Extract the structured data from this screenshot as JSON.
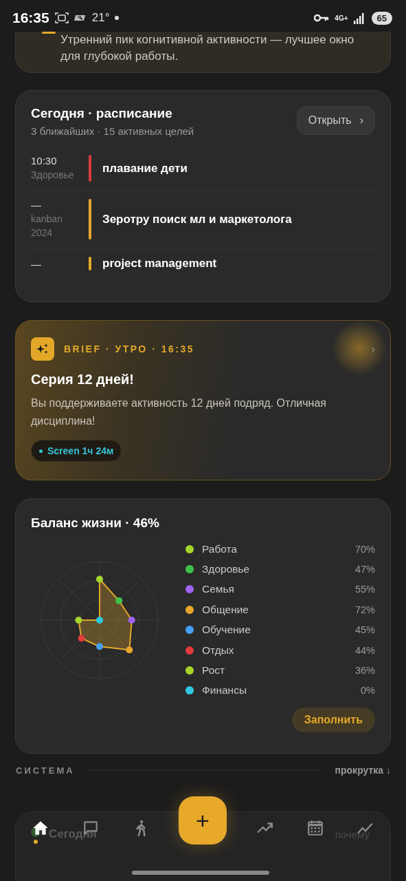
{
  "status_bar": {
    "time": "16:35",
    "temperature": "21°",
    "battery": "65",
    "network": "4G+"
  },
  "insight": {
    "text": "Утренний пик когнитивной активности — лучшее окно для глубокой работы."
  },
  "schedule": {
    "title": "Сегодня · расписание",
    "subtitle": "3 ближайших · 15 активных целей",
    "open_button": "Открыть",
    "chevron": "›",
    "items": [
      {
        "time": "10:30",
        "tag": "Здоровье",
        "title": "плавание дети",
        "color": "#d43c3c"
      },
      {
        "time": "—",
        "tag": "kanban 2024",
        "title": "Зеротру поиск мл и маркетолога",
        "color": "#e3a82a"
      },
      {
        "time": "—",
        "title": "project management",
        "color": "#e3a82a"
      }
    ]
  },
  "brief": {
    "label": "BRIEF · УТРО · 16:35",
    "chevron": "›",
    "title": "Серия 12 дней!",
    "text": "Вы поддерживаете активность 12 дней подряд. Отличная дисциплина!",
    "chip": "Screen 1ч 24м"
  },
  "balance": {
    "title": "Баланс жизни · 46%",
    "button": "Заполнить",
    "items": [
      {
        "label": "Работа",
        "value": "70%",
        "color": "#a6d62a"
      },
      {
        "label": "Здоровье",
        "value": "47%",
        "color": "#3fc24a"
      },
      {
        "label": "Семья",
        "value": "55%",
        "color": "#a064f0"
      },
      {
        "label": "Общение",
        "value": "72%",
        "color": "#e8a62a"
      },
      {
        "label": "Обучение",
        "value": "45%",
        "color": "#45a0f5"
      },
      {
        "label": "Отдых",
        "value": "44%",
        "color": "#e03a3a"
      },
      {
        "label": "Рост",
        "value": "36%",
        "color": "#a6d62a"
      },
      {
        "label": "Финансы",
        "value": "0%",
        "color": "#2ec8e0"
      }
    ]
  },
  "section": {
    "title": "СИСТЕМА",
    "hint": "прокрутка ↓"
  },
  "peek_card": {
    "title": "Сегодня",
    "link": "почему"
  },
  "fab": {
    "label": "+"
  },
  "nav": {
    "items": [
      {
        "selected": true
      },
      {
        "selected": false
      },
      {
        "selected": false
      },
      {
        "selected": false
      },
      {
        "selected": false
      },
      {
        "selected": false
      }
    ]
  }
}
